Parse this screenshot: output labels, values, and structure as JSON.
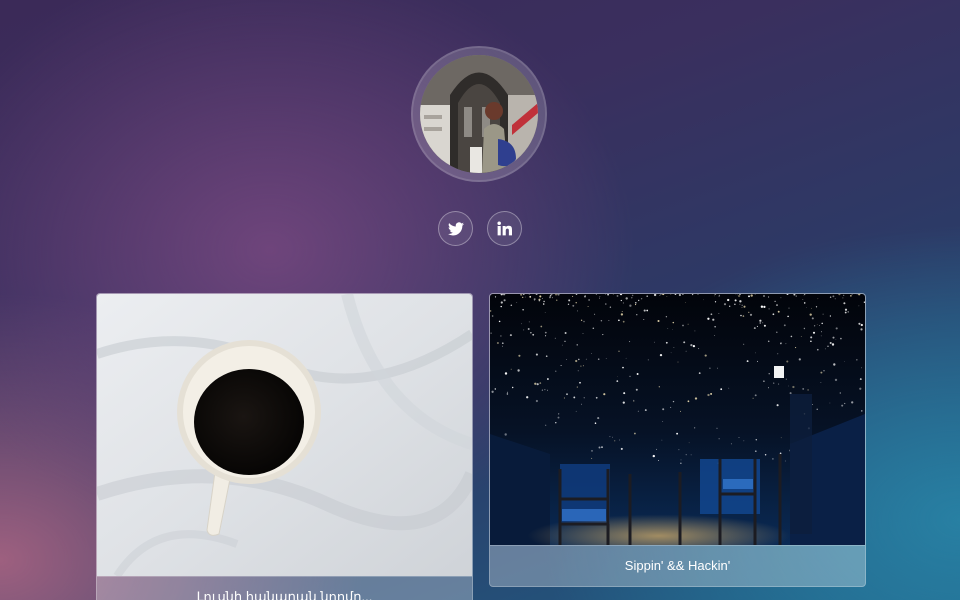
{
  "profile": {
    "avatar_alt": "Profile photo"
  },
  "social": [
    {
      "name": "twitter",
      "icon": "twitter-icon"
    },
    {
      "name": "linkedin",
      "icon": "linkedin-icon"
    }
  ],
  "cards": [
    {
      "title": "Լուսնի հանարան նոոմր...",
      "image": "coffee-cup-on-bedsheet"
    },
    {
      "title": "Sippin' && Hackin'",
      "image": "starry-ceiling-room"
    }
  ]
}
